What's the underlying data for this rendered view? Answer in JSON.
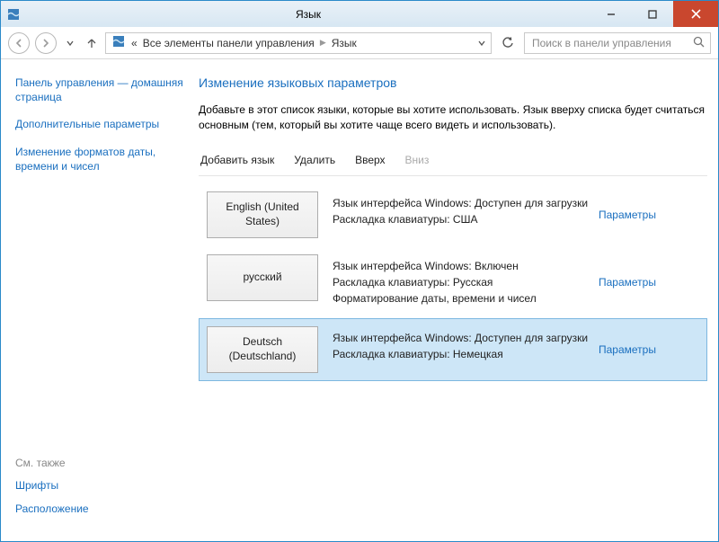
{
  "titlebar": {
    "title": "Язык"
  },
  "nav": {
    "crumb_prefix": "«",
    "crumb1": "Все элементы панели управления",
    "crumb2": "Язык",
    "search_placeholder": "Поиск в панели управления"
  },
  "sidebar": {
    "links": [
      "Панель управления — домашняя страница",
      "Дополнительные параметры",
      "Изменение форматов даты, времени и чисел"
    ],
    "seealso_label": "См. также",
    "seealso_links": [
      "Шрифты",
      "Расположение"
    ]
  },
  "main": {
    "heading": "Изменение языковых параметров",
    "description": "Добавьте в этот список языки, которые вы хотите использовать. Язык вверху списка будет считаться основным (тем, который вы хотите чаще всего видеть и использовать).",
    "toolbar": {
      "add": "Добавить язык",
      "remove": "Удалить",
      "up": "Вверх",
      "down": "Вниз"
    },
    "options_label": "Параметры",
    "languages": [
      {
        "name": "English (United States)",
        "lines": [
          "Язык интерфейса Windows: Доступен для загрузки",
          "Раскладка клавиатуры: США"
        ],
        "selected": false
      },
      {
        "name": "русский",
        "lines": [
          "Язык интерфейса Windows: Включен",
          "Раскладка клавиатуры: Русская",
          "Форматирование даты, времени и чисел"
        ],
        "selected": false
      },
      {
        "name": "Deutsch (Deutschland)",
        "lines": [
          "Язык интерфейса Windows: Доступен для загрузки",
          "Раскладка клавиатуры: Немецкая"
        ],
        "selected": true
      }
    ]
  }
}
